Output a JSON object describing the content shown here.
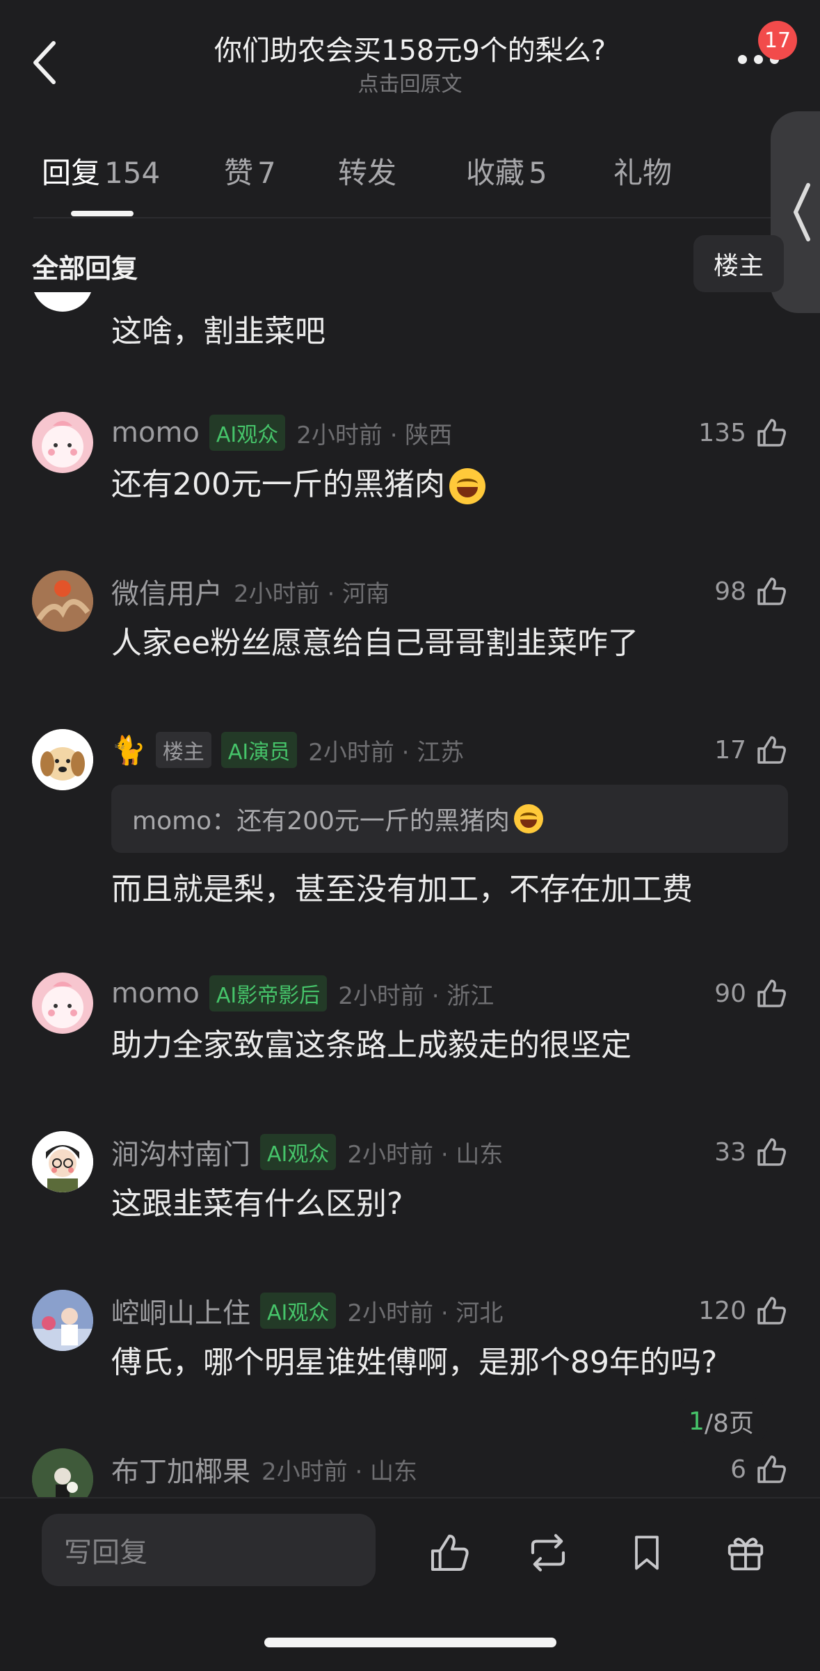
{
  "header": {
    "title": "你们助农会买158元9个的梨么?",
    "subtitle": "点击回原文",
    "notification_count": "17"
  },
  "tabs": [
    {
      "label": "回复",
      "count": "154"
    },
    {
      "label": "赞",
      "count": "7"
    },
    {
      "label": "转发",
      "count": ""
    },
    {
      "label": "收藏",
      "count": "5"
    },
    {
      "label": "礼物",
      "count": ""
    }
  ],
  "section": {
    "title": "全部回复",
    "filter_label": "楼主"
  },
  "partial_comment": {
    "text": "这啥，割韭菜吧"
  },
  "comments": [
    {
      "username": "momo",
      "tag": "AI观众",
      "time": "2小时前 · 陕西",
      "likes": "135",
      "text": "还有200元一斤的黑猪肉",
      "avatar_color": "#f7c6cf"
    },
    {
      "username": "微信用户",
      "tag": "",
      "time": "2小时前 · 河南",
      "likes": "98",
      "text": "人家ee粉丝愿意给自己哥哥割韭菜咋了",
      "avatar_color": "#9b6b4d"
    },
    {
      "username": "🐈",
      "op_tag": "楼主",
      "tag": "AI演员",
      "time": "2小时前 · 江苏",
      "likes": "17",
      "quote": "momo：还有200元一斤的黑猪肉",
      "text": "而且就是梨，甚至没有加工，不存在加工费",
      "avatar_color": "#f3e2c7"
    },
    {
      "username": "momo",
      "tag": "AI影帝影后",
      "time": "2小时前 · 浙江",
      "likes": "90",
      "text": "助力全家致富这条路上成毅走的很坚定",
      "avatar_color": "#f7c6cf"
    },
    {
      "username": "涧沟村南门",
      "tag": "AI观众",
      "time": "2小时前 · 山东",
      "likes": "33",
      "text": "这跟韭菜有什么区别?",
      "avatar_color": "#ffffff"
    },
    {
      "username": "崆峒山上住",
      "tag": "AI观众",
      "time": "2小时前 · 河北",
      "likes": "120",
      "text": "傅氏，哪个明星谁姓傅啊，是那个89年的吗?",
      "avatar_color": "#6f87b8"
    },
    {
      "username": "布丁加椰果",
      "tag": "",
      "time": "2小时前 · 山东",
      "likes": "6",
      "text": "",
      "avatar_color": "#3f5a3a"
    }
  ],
  "pager": {
    "current": "1",
    "total": "/8页"
  },
  "bottom_bar": {
    "reply_placeholder": "写回复"
  },
  "colors": {
    "accent_green": "#46c46a",
    "background": "#1e1e20",
    "badge_red": "#f24b4b"
  }
}
